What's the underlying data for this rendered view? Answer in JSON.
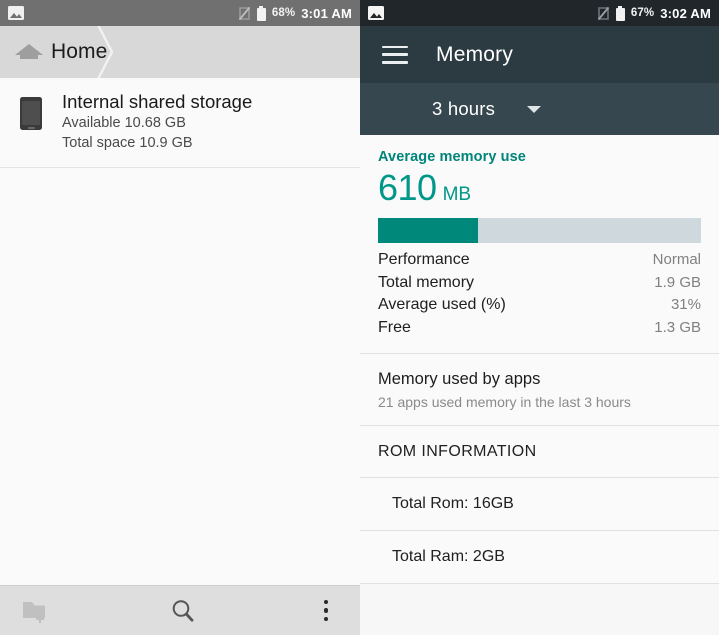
{
  "left": {
    "status_bar": {
      "notification_icon": "image-icon",
      "signal_icon": "no-sim-icon",
      "battery_icon": "battery-icon",
      "battery_percent": "68%",
      "time": "3:01 AM"
    },
    "breadcrumb": {
      "home_icon": "home-icon",
      "home_label": "Home",
      "separator_icon": "chevron-right-icon"
    },
    "storage_item": {
      "device_icon": "phone-storage-icon",
      "title": "Internal shared storage",
      "available": "Available 10.68 GB",
      "total": "Total space 10.9 GB"
    },
    "bottom_bar": {
      "new_folder_icon": "new-folder-icon",
      "search_icon": "search-icon",
      "overflow_icon": "overflow-menu-icon"
    }
  },
  "right": {
    "status_bar": {
      "notification_icon": "image-icon",
      "signal_icon": "no-sim-icon",
      "battery_icon": "battery-icon",
      "battery_percent": "67%",
      "time": "3:02 AM"
    },
    "app_bar": {
      "menu_icon": "hamburger-menu-icon",
      "title": "Memory"
    },
    "range_selector": {
      "value": "3 hours",
      "caret_icon": "chevron-down-icon"
    },
    "memory_card": {
      "label": "Average memory use",
      "value": "610",
      "unit": "MB",
      "usage_percent": 31,
      "stats": [
        {
          "key": "Performance",
          "value": "Normal"
        },
        {
          "key": "Total memory",
          "value": "1.9 GB"
        },
        {
          "key": "Average used (%)",
          "value": "31%"
        },
        {
          "key": "Free",
          "value": "1.3 GB"
        }
      ]
    },
    "apps_section": {
      "title": "Memory used by apps",
      "subtitle": "21 apps used memory in the last 3 hours"
    },
    "rom_section": {
      "header": "ROM INFORMATION",
      "rows": [
        {
          "label": "Total Rom: 16GB"
        },
        {
          "label": "Total Ram: 2GB"
        }
      ]
    }
  },
  "colors": {
    "accent_teal": "#009688",
    "bar_fill": "#00897b",
    "bar_track": "#cfd8dc",
    "appbar_dark": "#2c3a41",
    "range_bar": "#37474f",
    "statusbar_left": "#707070",
    "statusbar_right": "#21262b"
  }
}
